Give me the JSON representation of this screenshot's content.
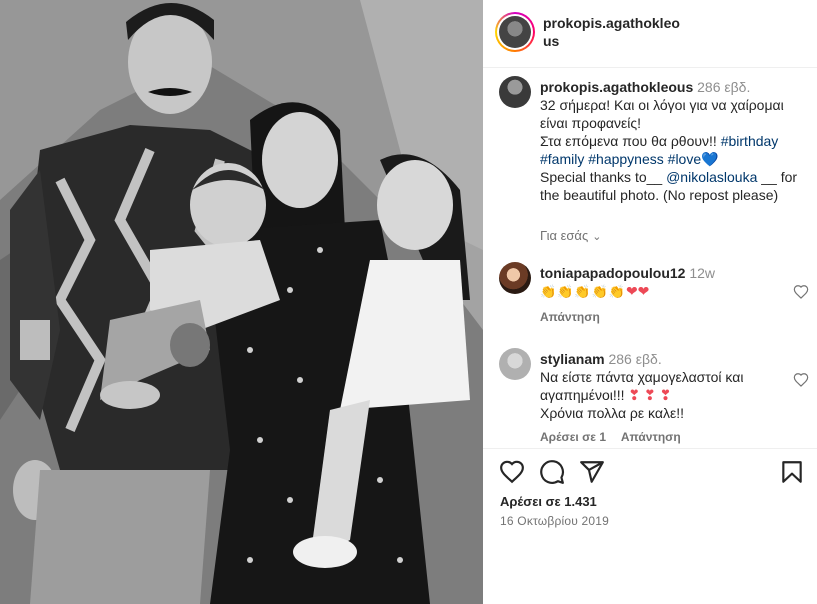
{
  "post": {
    "author": "prokopis.agathokleous",
    "photo_alt": "family photo"
  },
  "caption": {
    "username": "prokopis.agathokleous",
    "time": "286 εβδ.",
    "line1": "32 σήμερα! Και οι λόγοι για να χαίρομαι είναι προφανείς!",
    "line2_text": "Στα επόμενα που θα ρθουν!! ",
    "tag_birthday": "#birthday",
    "tag_family": "#family",
    "tag_happyness": "#happyness",
    "tag_love": "#love",
    "heart": "💙",
    "thanks_prefix": "Special thanks to__ ",
    "mention": "@nikolaslouka",
    "thanks_suffix": " __ for the beautiful photo. (No repost please)",
    "translate": "Για εσάς",
    "translate_chevron": "⌄"
  },
  "comments": [
    {
      "username": "toniapapadopoulou12",
      "time": "12w",
      "claps": "👏👏👏👏👏",
      "hearts": "❤❤",
      "reply": "Απάντηση"
    },
    {
      "username": "stylianam",
      "time": "286 εβδ.",
      "text1": "Να είστε πάντα χαμογελαστοί και αγαπημένοι!!! ",
      "hearts": "❣ ❣ ❣",
      "text2": "Χρόνια πολλα ρε καλε!!",
      "see_replies": "Αρέσει σε 1",
      "reply": "Απάντηση"
    }
  ],
  "footer": {
    "likes": "Αρέσει σε 1.431",
    "date": "16 Οκτωβρίου 2019"
  },
  "icons": {
    "like": "heart-icon",
    "comment": "comment-icon",
    "share": "share-icon",
    "save": "bookmark-icon"
  },
  "colors": {
    "link": "#00376b",
    "muted": "#737373",
    "red": "#ed4956",
    "divider": "#efefef"
  }
}
